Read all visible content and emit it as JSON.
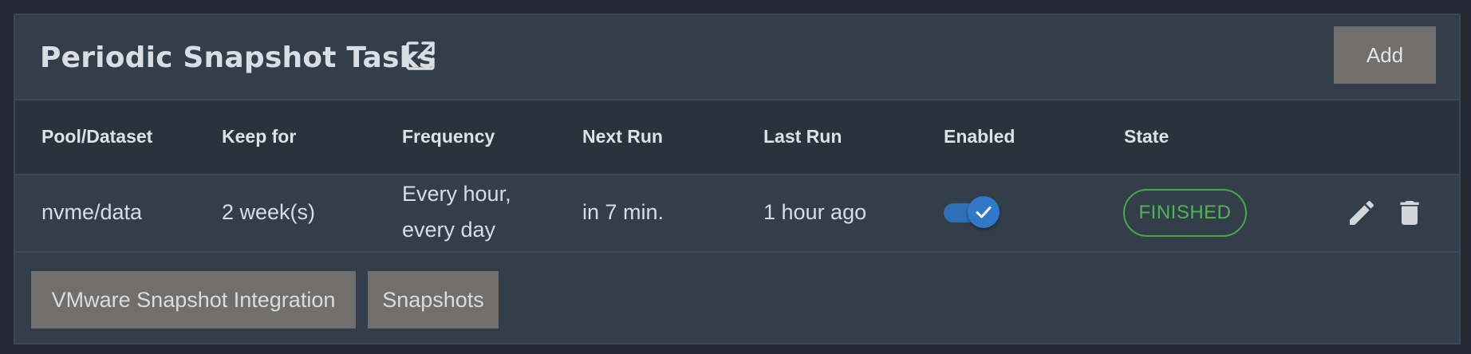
{
  "card": {
    "title": "Periodic Snapshot Tasks",
    "add_label": "Add"
  },
  "table": {
    "columns": [
      "Pool/Dataset",
      "Keep for",
      "Frequency",
      "Next Run",
      "Last Run",
      "Enabled",
      "State"
    ],
    "rows": [
      {
        "pool_dataset": "nvme/data",
        "keep_for": "2 week(s)",
        "frequency_line1": "Every hour,",
        "frequency_line2": "every day",
        "next_run": "in 7 min.",
        "last_run": "1 hour ago",
        "enabled": true,
        "state": "FINISHED"
      }
    ]
  },
  "footer": {
    "vmware_label": "VMware Snapshot Integration",
    "snapshots_label": "Snapshots"
  },
  "icons": {
    "external_link": "open-in-new-icon",
    "edit": "pencil-icon",
    "delete": "trash-icon",
    "check": "check-icon"
  },
  "colors": {
    "background": "#222933",
    "card": "#333e4a",
    "header_row": "#2a323c",
    "button": "#706f6d",
    "toggle": "#3078c8",
    "state_finished": "#4fb554"
  }
}
